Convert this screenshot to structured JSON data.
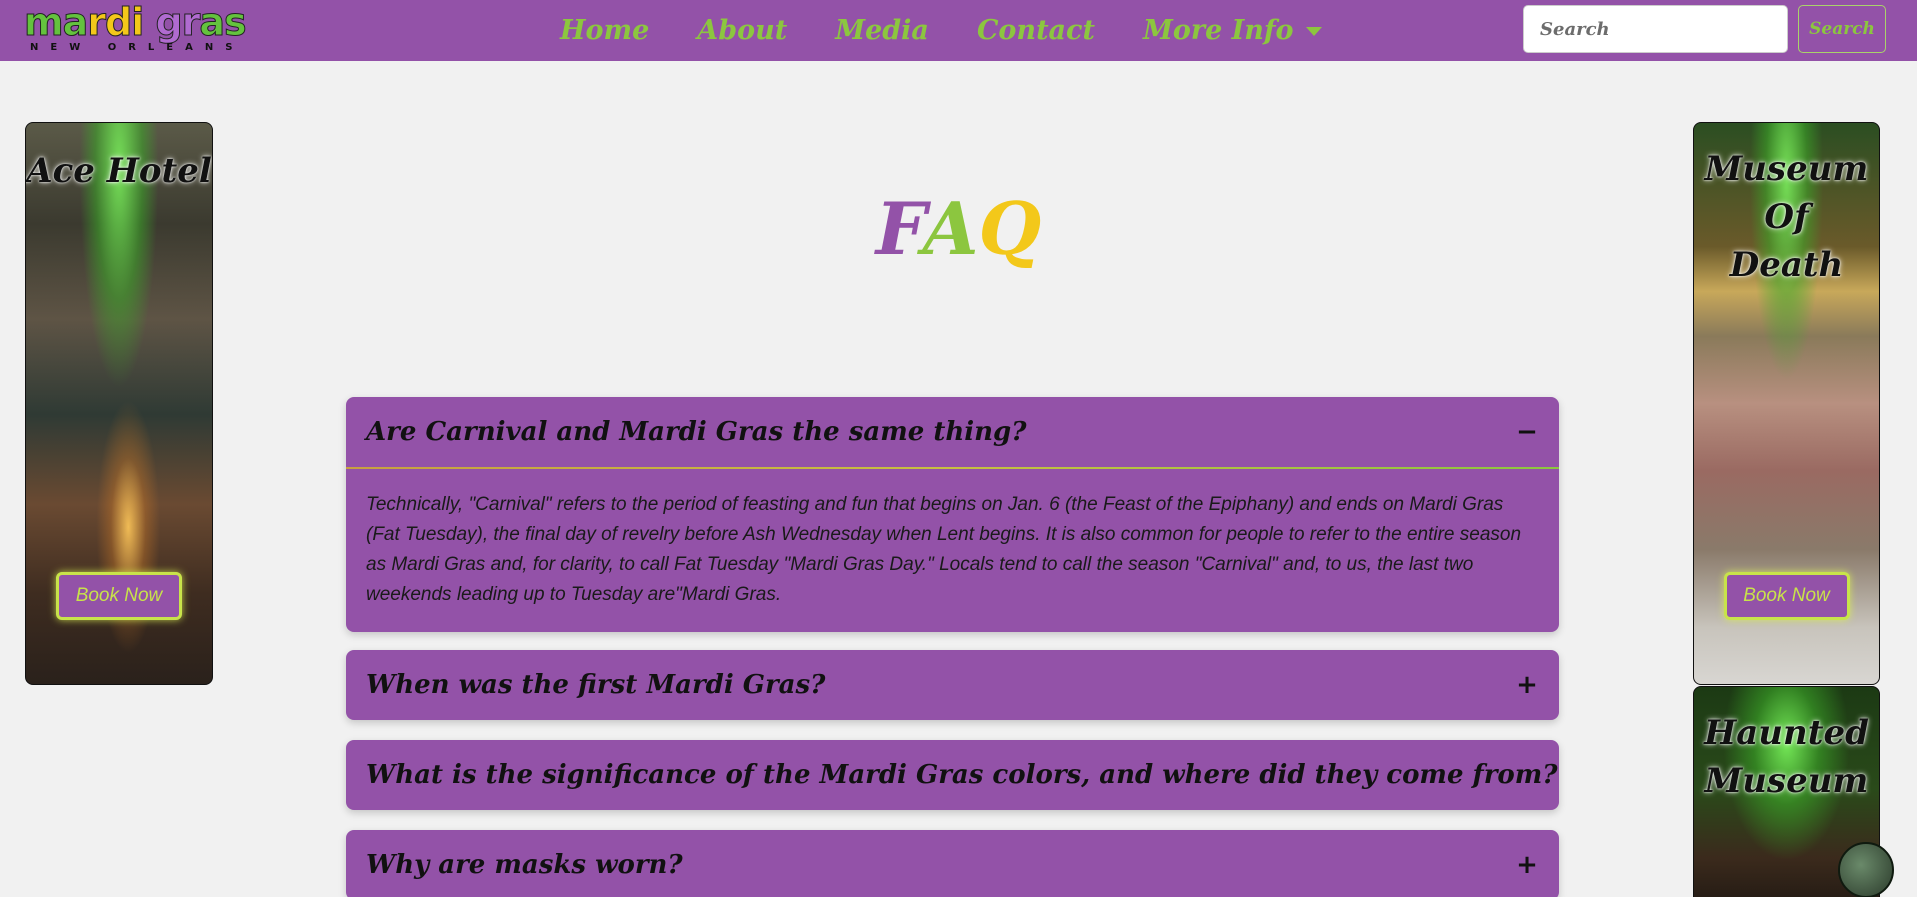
{
  "nav": {
    "logo": {
      "top_parts": [
        "ma",
        "rdi ",
        "gr",
        "as"
      ],
      "bottom": "NEW ORLEANS"
    },
    "links": [
      {
        "label": "Home"
      },
      {
        "label": "About"
      },
      {
        "label": "Media"
      },
      {
        "label": "Contact"
      },
      {
        "label": "More Info"
      }
    ],
    "search": {
      "placeholder": "Search",
      "button_label": "Search"
    }
  },
  "page_title": {
    "letters": [
      "F",
      "A",
      "Q"
    ]
  },
  "faq": [
    {
      "question": "Are Carnival and Mardi Gras the same thing?",
      "toggle": "−",
      "answer": "Technically, \"Carnival\" refers to the period of feasting and fun that begins on Jan. 6 (the Feast of the Epiphany) and ends on Mardi Gras (Fat Tuesday), the final day of revelry before Ash Wednesday when Lent begins. It is also common for people to refer to the entire season as Mardi Gras and, for clarity, to call Fat Tuesday \"Mardi Gras Day.\" Locals tend to call the season \"Carnival\" and, to us, the last two weekends leading up to Tuesday are\"Mardi Gras."
    },
    {
      "question": "When was the first Mardi Gras?",
      "toggle": "+"
    },
    {
      "question": "What is the significance of the Mardi Gras colors, and where did they come from?",
      "toggle": "+"
    },
    {
      "question": "Why are masks worn?",
      "toggle": "+"
    }
  ],
  "ads": {
    "left": {
      "title": "Ace Hotel",
      "button": "Book Now"
    },
    "right1": {
      "title_line1": "Museum Of",
      "title_line2": "Death",
      "button": "Book Now"
    },
    "right2": {
      "title_line1": "Haunted",
      "title_line2": "Museum"
    }
  },
  "colors": {
    "purple": "#9352a8",
    "green": "#8cc63f",
    "gold": "#f3c81a"
  }
}
